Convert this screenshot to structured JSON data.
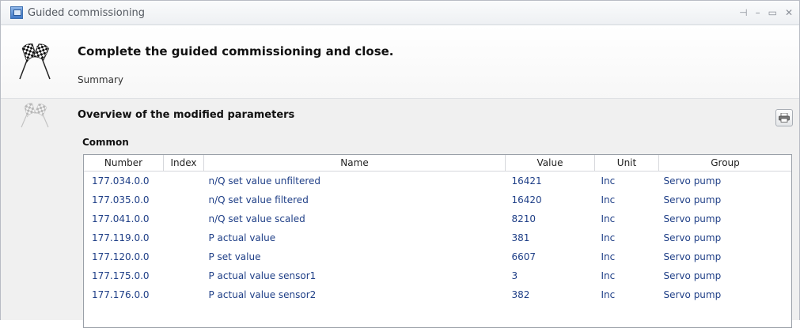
{
  "window": {
    "title": "Guided commissioning",
    "controls": {
      "pin": "⊣",
      "minimize": "–",
      "maximize": "▭",
      "close": "✕"
    }
  },
  "header": {
    "heading": "Complete the guided commissioning and close.",
    "subheading": "Summary",
    "icon": "checkered-flags-icon"
  },
  "section": {
    "heading": "Overview of the modified parameters",
    "group_label": "Common",
    "icon": "checkered-flags-icon",
    "print_icon": "print-icon"
  },
  "table": {
    "columns": [
      "Number",
      "Index",
      "Name",
      "Value",
      "Unit",
      "Group"
    ],
    "rows": [
      {
        "number": "177.034.0.0",
        "index": "",
        "name": "n/Q set value unfiltered",
        "value": "16421",
        "unit": "Inc",
        "group": "Servo pump"
      },
      {
        "number": "177.035.0.0",
        "index": "",
        "name": "n/Q set value filtered",
        "value": "16420",
        "unit": "Inc",
        "group": "Servo pump"
      },
      {
        "number": "177.041.0.0",
        "index": "",
        "name": "n/Q set value scaled",
        "value": "8210",
        "unit": "Inc",
        "group": "Servo pump"
      },
      {
        "number": "177.119.0.0",
        "index": "",
        "name": "P actual value",
        "value": "381",
        "unit": "Inc",
        "group": "Servo pump"
      },
      {
        "number": "177.120.0.0",
        "index": "",
        "name": "P set value",
        "value": "6607",
        "unit": "Inc",
        "group": "Servo pump"
      },
      {
        "number": "177.175.0.0",
        "index": "",
        "name": "P actual value sensor1",
        "value": "3",
        "unit": "Inc",
        "group": "Servo pump"
      },
      {
        "number": "177.176.0.0",
        "index": "",
        "name": "P actual value sensor2",
        "value": "382",
        "unit": "Inc",
        "group": "Servo pump"
      }
    ]
  },
  "colors": {
    "text_link": "#1f3f87",
    "panel_bg": "#f0f0f0"
  }
}
